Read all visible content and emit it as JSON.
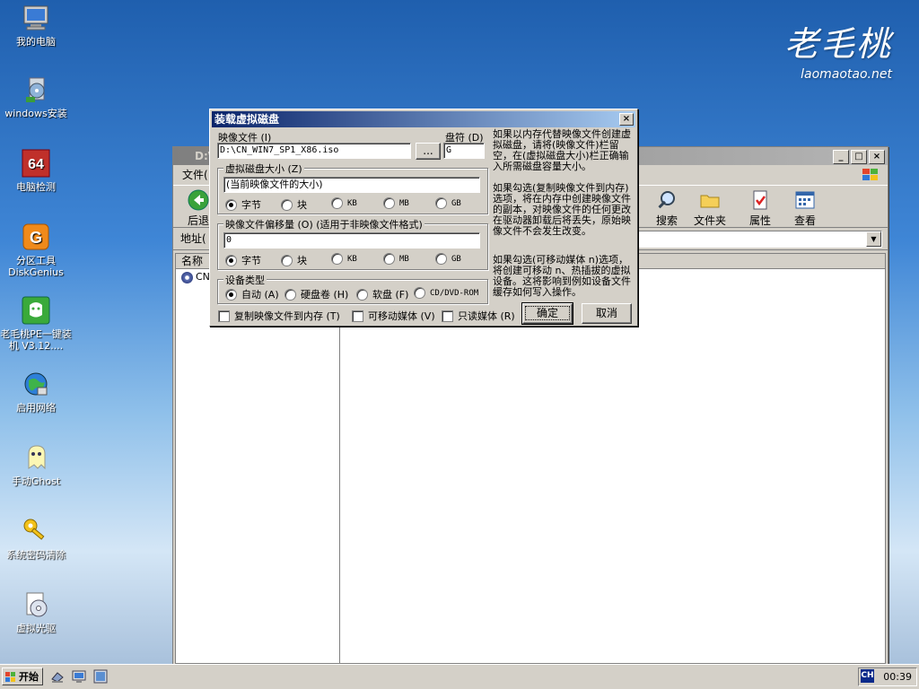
{
  "brand": {
    "logo": "老毛桃",
    "site": "laomaotao.net"
  },
  "desktop_icons": [
    {
      "label": "我的电脑"
    },
    {
      "label": "windows安装"
    },
    {
      "label": "电脑检测"
    },
    {
      "label": "分区工具DiskGenius"
    },
    {
      "label": "老毛桃PE一键装机 V3.12...."
    },
    {
      "label": "启用网络"
    },
    {
      "label": "手动Ghost"
    },
    {
      "label": "系统密码清除"
    },
    {
      "label": "虚拟光驱"
    }
  ],
  "explorer": {
    "title": "D:\\",
    "menu_first": "文件(",
    "toolbar": {
      "back": "后退",
      "search": "搜索",
      "folders": "文件夹",
      "properties": "属性",
      "view": "查看"
    },
    "address_label": "地址(",
    "column_name": "名称",
    "tree_item": "CN_"
  },
  "dialog": {
    "title": "装载虚拟磁盘",
    "image_file_label": "映像文件 (I)",
    "image_file_value": "D:\\CN_WIN7_SP1_X86.iso",
    "browse_label": "...",
    "drive_label": "盘符 (D)",
    "drive_value": "G",
    "size_group": "虚拟磁盘大小 (Z)",
    "size_value": "(当前映像文件的大小)",
    "offset_group": "映像文件偏移量 (O)  (适用于非映像文件格式)",
    "offset_value": "0",
    "units": [
      "字节",
      "块",
      "KB",
      "MB",
      "GB"
    ],
    "device_group": "设备类型",
    "device_types": [
      "自动 (A)",
      "硬盘卷 (H)",
      "软盘 (F)",
      "CD/DVD-ROM"
    ],
    "copy_to_memory": "复制映像文件到内存 (T)",
    "removable": "可移动媒体 (V)",
    "read_only": "只读媒体 (R)",
    "ok": "确定",
    "cancel": "取消",
    "help1": "如果以内存代替映像文件创建虚拟磁盘，请将(映像文件)栏留空，在(虚拟磁盘大小)栏正确输入所需磁盘容量大小。",
    "help2": "如果勾选(复制映像文件到内存)选项，将在内存中创建映像文件的副本，对映像文件的任何更改在驱动器卸载后将丢失，原始映像文件不会发生改变。",
    "help3": "如果勾选(可移动媒体 n)选项，将创建可移动 n、热插拔的虚拟设备。这将影响到例如设备文件缓存如何写入操作。"
  },
  "taskbar": {
    "start": "开始",
    "lang": "CH",
    "clock": "00:39"
  }
}
